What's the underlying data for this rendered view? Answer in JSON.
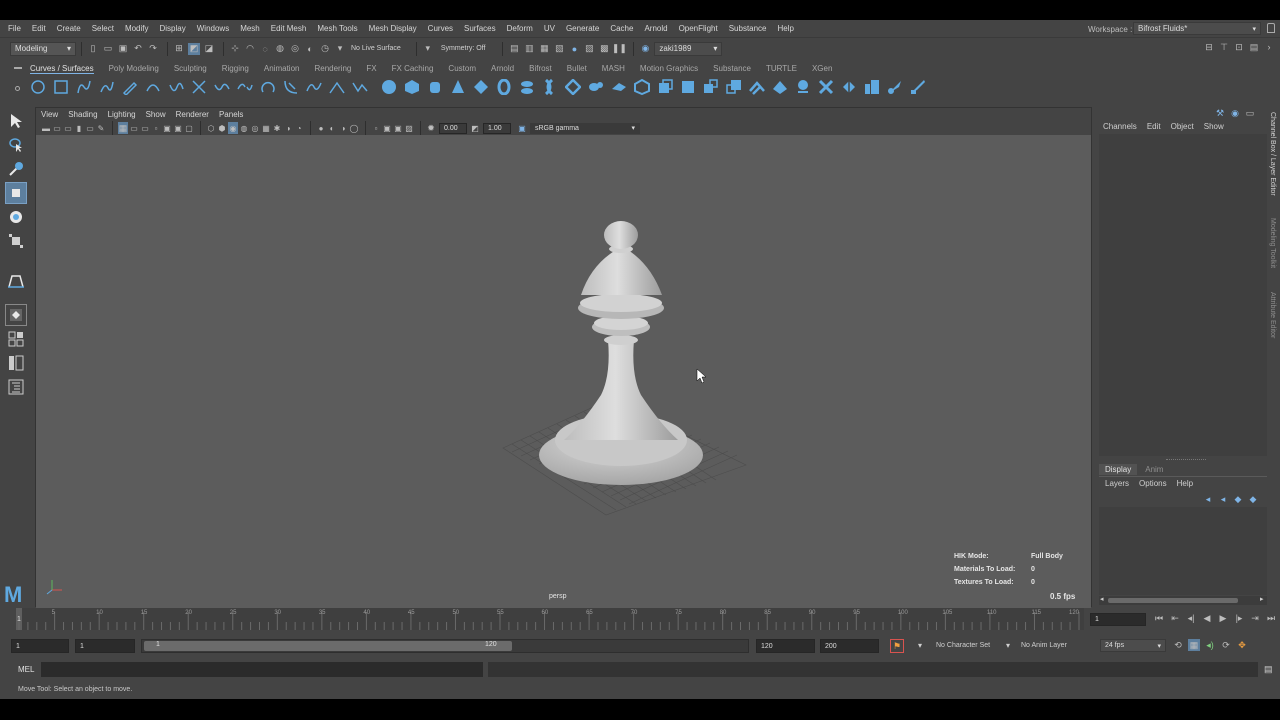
{
  "menubar": {
    "items": [
      "File",
      "Edit",
      "Create",
      "Select",
      "Modify",
      "Display",
      "Windows",
      "Mesh",
      "Edit Mesh",
      "Mesh Tools",
      "Mesh Display",
      "Curves",
      "Surfaces",
      "Deform",
      "UV",
      "Generate",
      "Cache",
      "Arnold",
      "OpenFlight",
      "Substance",
      "Help"
    ],
    "workspace_label": "Workspace :",
    "workspace_value": "Bifrost Fluids*"
  },
  "status_line": {
    "mode_menu": "Modeling",
    "live_surface": "No Live Surface",
    "symmetry": "Symmetry: Off",
    "user": "zaki1989"
  },
  "shelf": {
    "tabs": [
      "Curves / Surfaces",
      "Poly Modeling",
      "Sculpting",
      "Rigging",
      "Animation",
      "Rendering",
      "FX",
      "FX Caching",
      "Custom",
      "Arnold",
      "Bifrost",
      "Bullet",
      "MASH",
      "Motion Graphics",
      "Substance",
      "TURTLE",
      "XGen"
    ],
    "active_tab": "Curves / Surfaces"
  },
  "viewport": {
    "menu": [
      "View",
      "Shading",
      "Lighting",
      "Show",
      "Renderer",
      "Panels"
    ],
    "exposure": "0.00",
    "gamma": "1.00",
    "color_space": "sRGB gamma",
    "camera_label": "persp",
    "hud": {
      "hik_mode_label": "HIK Mode:",
      "hik_mode_value": "Full Body",
      "materials_label": "Materials To Load:",
      "materials_value": "0",
      "textures_label": "Textures To Load:",
      "textures_value": "0",
      "fps": "0.5 fps"
    }
  },
  "channel_box": {
    "menu": [
      "Channels",
      "Edit",
      "Object",
      "Show"
    ],
    "side_tabs": [
      "Channel Box / Layer Editor",
      "Modeling Toolkit",
      "Attribute Editor"
    ]
  },
  "layer_editor": {
    "tabs": [
      "Display",
      "Anim"
    ],
    "active_tab": "Display",
    "menu": [
      "Layers",
      "Options",
      "Help"
    ]
  },
  "timeline": {
    "ticks": [
      "5",
      "10",
      "15",
      "20",
      "25",
      "30",
      "35",
      "40",
      "45",
      "50",
      "55",
      "60",
      "65",
      "70",
      "75",
      "80",
      "85",
      "90",
      "95",
      "100",
      "105",
      "110",
      "115",
      "120"
    ],
    "current_frame": "1",
    "current_frame_field": "1"
  },
  "range_slider": {
    "start": "1",
    "playback_start": "1",
    "slider_start": "1",
    "slider_end": "120",
    "playback_end": "120",
    "end": "200",
    "character_set": "No Character Set",
    "anim_layer": "No Anim Layer",
    "fps": "24 fps"
  },
  "command_line": {
    "label": "MEL"
  },
  "help_line": {
    "text": "Move Tool: Select an object to move."
  },
  "colors": {
    "accent_blue": "#5fa9e0",
    "viewport_bg": "#5c5c5c",
    "ui_bg": "#444444"
  }
}
